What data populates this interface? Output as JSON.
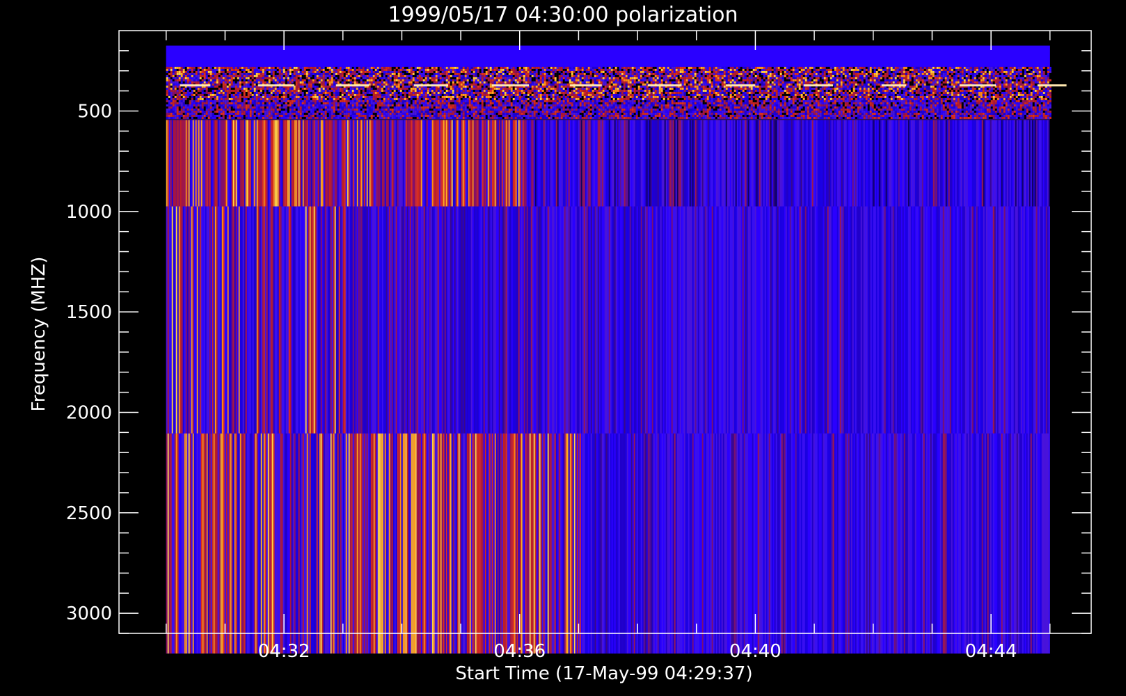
{
  "chart_data": {
    "type": "heatmap",
    "title": "1999/05/17 04:30:00 polarization",
    "xlabel": "Start Time (17-May-99 04:29:37)",
    "ylabel": "Frequency (MHZ)",
    "x_ticks": [
      "04:32",
      "04:36",
      "04:40",
      "04:44"
    ],
    "x_tick_minutes": [
      32,
      36,
      40,
      44
    ],
    "y_ticks": [
      500,
      1000,
      1500,
      2000,
      2500,
      3000
    ],
    "x_range_minutes": [
      29.2,
      45.7
    ],
    "y_range_mhz": [
      3100,
      100
    ],
    "data_extent": {
      "time_start_minutes": 30.0,
      "time_end_minutes": 45.0,
      "freq_top_mhz": 175,
      "freq_bottom_mhz": 3200
    },
    "bands": [
      {
        "freq_from": 175,
        "freq_to": 280,
        "pattern": "uniform"
      },
      {
        "freq_from": 280,
        "freq_to": 545,
        "pattern": "speckle"
      },
      {
        "freq_from": 545,
        "freq_to": 975,
        "pattern": "stripes",
        "warm_until_minutes": 36.1
      },
      {
        "freq_from": 975,
        "freq_to": 2105,
        "pattern": "stripes",
        "warm_until_minutes": 33.1
      },
      {
        "freq_from": 2105,
        "freq_to": 3200,
        "pattern": "stripes",
        "warm_until_minutes": 37.1
      }
    ],
    "colors": {
      "background": "#000000",
      "axes": "#ffffff",
      "low": "#2a00ff",
      "mid": "#c02020",
      "high": "#ff9a1a"
    },
    "grid": false
  }
}
